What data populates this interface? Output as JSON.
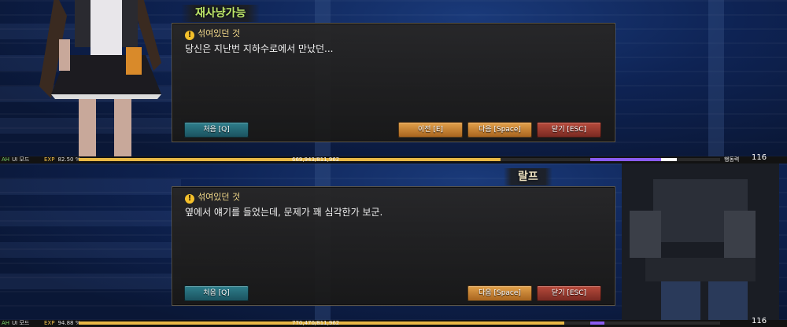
{
  "panels": [
    {
      "npc_name": "재사냥가능",
      "quest_title": "섞여있던 것",
      "dialog_text": "당신은 지난번 지하수로에서 만났던...",
      "buttons": {
        "first": "처음 [Q]",
        "prev": "이전 [E]",
        "next": "다음 [Space]",
        "close": "닫기 [ESC]"
      },
      "hud": {
        "ah": "AH",
        "ui_mode": "UI 모드",
        "exp_label": "EXP",
        "exp_percent": "82.50 %",
        "exp_fraction": 0.825,
        "exp_value": "669,943/811,962",
        "stamina_label": "행동력",
        "level": "116"
      }
    },
    {
      "npc_name": "랄프",
      "quest_title": "섞여있던 것",
      "dialog_text": "옆에서 얘기를 들었는데, 문제가 꽤 심각한가 보군.",
      "buttons": {
        "first": "처음 [Q]",
        "next": "다음 [Space]",
        "close": "닫기 [ESC]"
      },
      "hud": {
        "ah": "AH",
        "ui_mode": "UI 모드",
        "exp_label": "EXP",
        "exp_percent": "94.88 %",
        "exp_fraction": 0.9488,
        "exp_value": "770,470/811,962",
        "level": "116"
      }
    }
  ],
  "colors": {
    "npc_name": "#bfe86a",
    "quest_title": "#f2d98a",
    "exp_bar": "#e8b845",
    "stamina_bar": "#8a5cf0"
  },
  "icons": [
    "warning-icon"
  ]
}
